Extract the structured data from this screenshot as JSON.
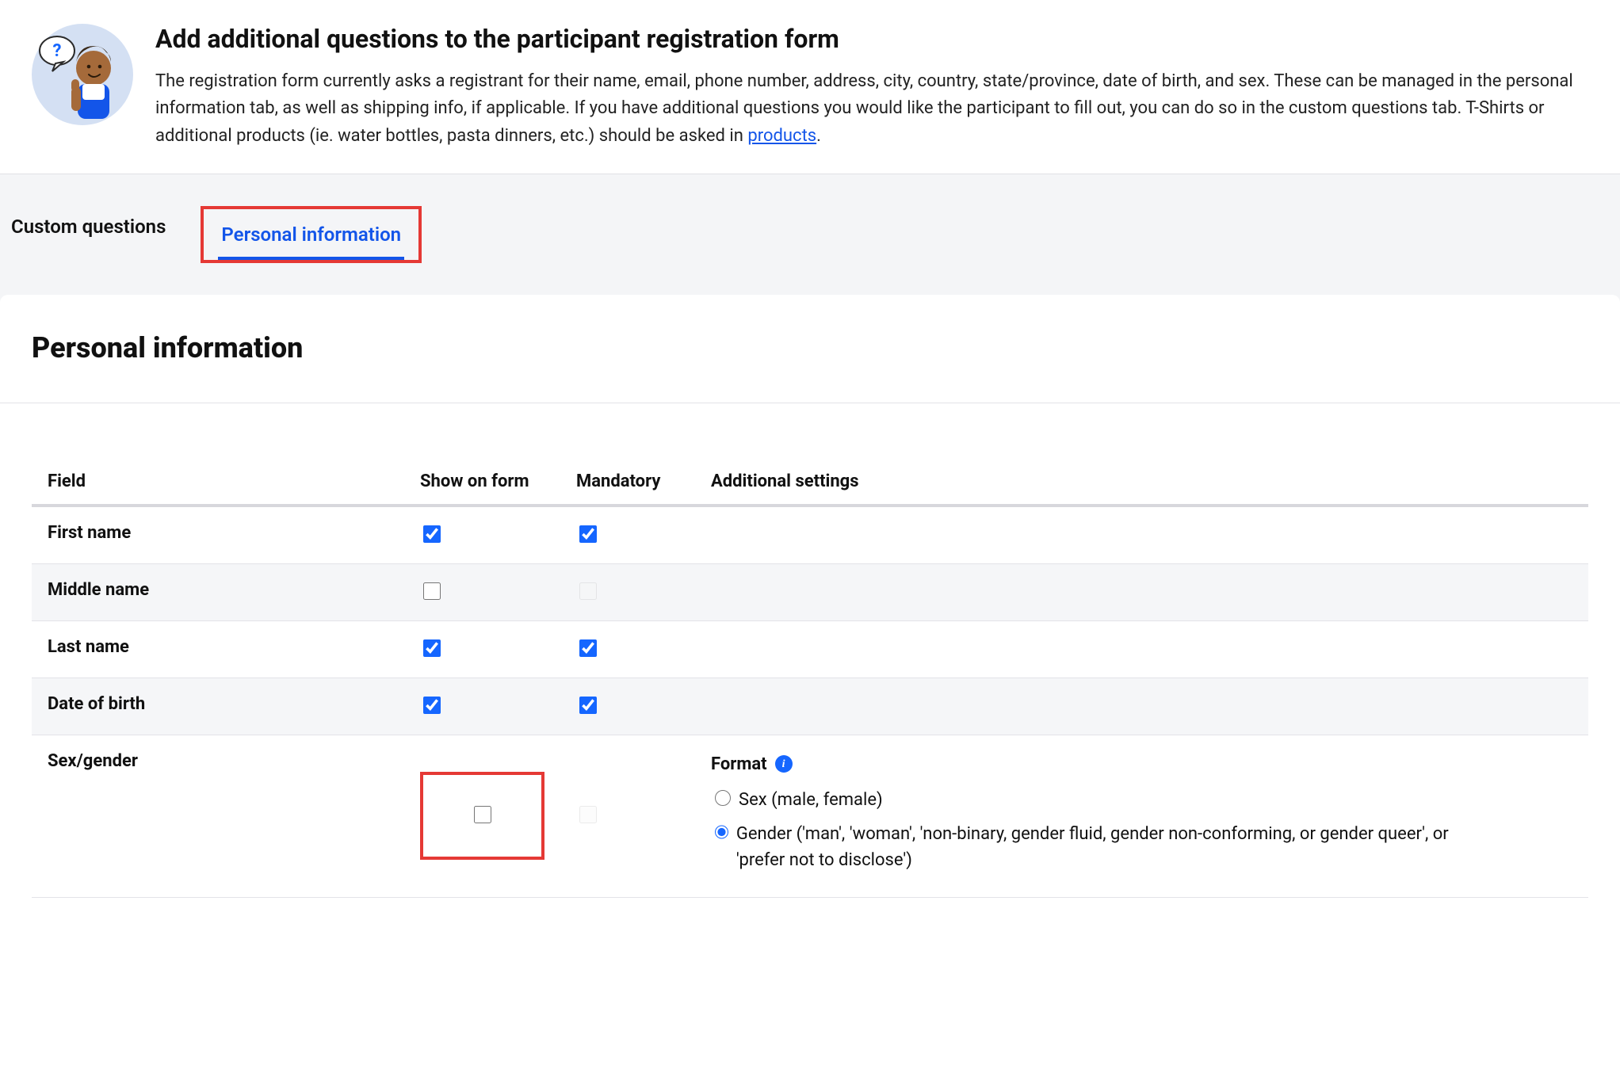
{
  "header": {
    "title": "Add additional questions to the participant registration form",
    "description_parts": {
      "pre": "The registration form currently asks a registrant for their name, email, phone number, address, city, country, state/province, date of birth, and sex. These can be managed in the personal information tab, as well as shipping info, if applicable. If you have additional questions you would like the participant to fill out, you can do so in the custom questions tab. T-Shirts or additional products (ie. water bottles, pasta dinners, etc.) should be asked in ",
      "link_text": "products",
      "post": "."
    }
  },
  "tabs": {
    "custom_questions_label": "Custom questions",
    "personal_information_label": "Personal information"
  },
  "section": {
    "title": "Personal information"
  },
  "table": {
    "headers": {
      "field": "Field",
      "show_on_form": "Show on form",
      "mandatory": "Mandatory",
      "additional_settings": "Additional settings"
    },
    "rows": {
      "first_name": {
        "label": "First name",
        "show": true,
        "mandatory": true
      },
      "middle_name": {
        "label": "Middle name",
        "show": false,
        "mandatory_disabled": true
      },
      "last_name": {
        "label": "Last name",
        "show": true,
        "mandatory": true
      },
      "date_of_birth": {
        "label": "Date of birth",
        "show": true,
        "mandatory": true
      },
      "sex_gender": {
        "label": "Sex/gender",
        "show": false,
        "mandatory_disabled": true
      }
    }
  },
  "sex_gender_settings": {
    "format_label": "Format",
    "options": {
      "sex": "Sex (male, female)",
      "gender": "Gender ('man', 'woman', 'non-binary, gender fluid, gender non-conforming, or gender queer', or 'prefer not to disclose')"
    },
    "selected": "gender"
  }
}
